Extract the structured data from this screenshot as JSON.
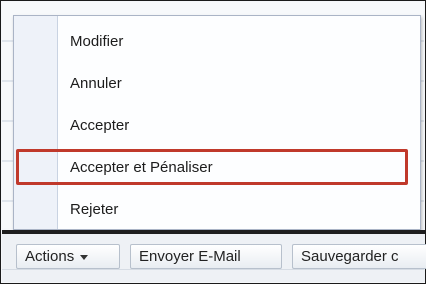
{
  "menu": {
    "items": [
      {
        "label": "Modifier"
      },
      {
        "label": "Annuler"
      },
      {
        "label": "Accepter"
      },
      {
        "label": "Accepter et Pénaliser",
        "highlighted": true
      },
      {
        "label": "Rejeter"
      }
    ],
    "highlight_color": "#c0392b"
  },
  "toolbar": {
    "actions_label": "Actions",
    "actions_icon": "caret-down-icon",
    "email_label": "Envoyer E-Mail",
    "save_label": "Sauvegarder c"
  }
}
